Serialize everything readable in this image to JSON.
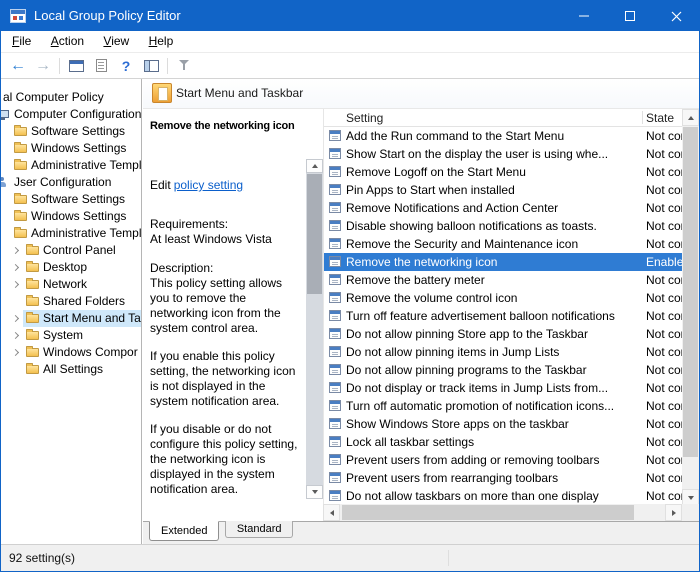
{
  "colors": {
    "titlebar": "#1164c7",
    "selection": "#2f7cd3",
    "tree_selection": "#cfe8fa",
    "link": "#0b5fcb",
    "folder": "#f3c04f"
  },
  "window": {
    "title": "Local Group Policy Editor"
  },
  "menu": {
    "items": [
      "File",
      "Action",
      "View",
      "Help"
    ]
  },
  "toolbar": {
    "glyphs": {
      "back": "←",
      "forward": "→",
      "help": "?"
    }
  },
  "tree": {
    "items": [
      {
        "label": "al Computer Policy"
      },
      {
        "label": "Computer Configuration"
      },
      {
        "label": "Software Settings"
      },
      {
        "label": "Windows Settings"
      },
      {
        "label": "Administrative Templ"
      },
      {
        "label": "Jser Configuration"
      },
      {
        "label": "Software Settings"
      },
      {
        "label": "Windows Settings"
      },
      {
        "label": "Administrative Templ"
      },
      {
        "label": "Control Panel"
      },
      {
        "label": "Desktop"
      },
      {
        "label": "Network"
      },
      {
        "label": "Shared Folders"
      },
      {
        "label": "Start Menu and Ta"
      },
      {
        "label": "System"
      },
      {
        "label": "Windows Compor"
      },
      {
        "label": "All Settings"
      }
    ]
  },
  "banner": {
    "title": "Start Menu and Taskbar"
  },
  "description": {
    "title": "Remove the networking icon",
    "edit_prefix": "Edit",
    "edit_link": "policy setting",
    "requirements_label": "Requirements:",
    "requirements": "At least Windows Vista",
    "description_label": "Description:",
    "paragraphs": [
      "This policy setting allows you to remove the networking icon from the system control area.",
      "If you enable this policy setting, the networking icon is not displayed in the system notification area.",
      "If you disable or do not configure this policy setting, the networking icon is displayed in the system notification area."
    ]
  },
  "list": {
    "columns": [
      "Setting",
      "State"
    ],
    "rows": [
      {
        "label": "Add the Run command to the Start Menu",
        "state": "Not configured"
      },
      {
        "label": "Show Start on the display the user is using whe...",
        "state": "Not configured"
      },
      {
        "label": "Remove Logoff on the Start Menu",
        "state": "Not configured"
      },
      {
        "label": "Pin Apps to Start when installed",
        "state": "Not configured"
      },
      {
        "label": "Remove Notifications and Action Center",
        "state": "Not configured"
      },
      {
        "label": "Disable showing balloon notifications as toasts.",
        "state": "Not configured"
      },
      {
        "label": "Remove the Security and Maintenance icon",
        "state": "Not configured"
      },
      {
        "label": "Remove the networking icon",
        "state": "Enabled"
      },
      {
        "label": "Remove the battery meter",
        "state": "Not configured"
      },
      {
        "label": "Remove the volume control icon",
        "state": "Not configured"
      },
      {
        "label": "Turn off feature advertisement balloon notifications",
        "state": "Not configured"
      },
      {
        "label": "Do not allow pinning Store app to the Taskbar",
        "state": "Not configured"
      },
      {
        "label": "Do not allow pinning items in Jump Lists",
        "state": "Not configured"
      },
      {
        "label": "Do not allow pinning programs to the Taskbar",
        "state": "Not configured"
      },
      {
        "label": "Do not display or track items in Jump Lists from...",
        "state": "Not configured"
      },
      {
        "label": "Turn off automatic promotion of notification icons...",
        "state": "Not configured"
      },
      {
        "label": "Show Windows Store apps on the taskbar",
        "state": "Not configured"
      },
      {
        "label": "Lock all taskbar settings",
        "state": "Not configured"
      },
      {
        "label": "Prevent users from adding or removing toolbars",
        "state": "Not configured"
      },
      {
        "label": "Prevent users from rearranging toolbars",
        "state": "Not configured"
      },
      {
        "label": "Do not allow taskbars on more than one display",
        "state": "Not configured"
      }
    ]
  },
  "tabs": {
    "items": [
      "Extended",
      "Standard"
    ]
  },
  "statusbar": {
    "text": "92 setting(s)"
  }
}
